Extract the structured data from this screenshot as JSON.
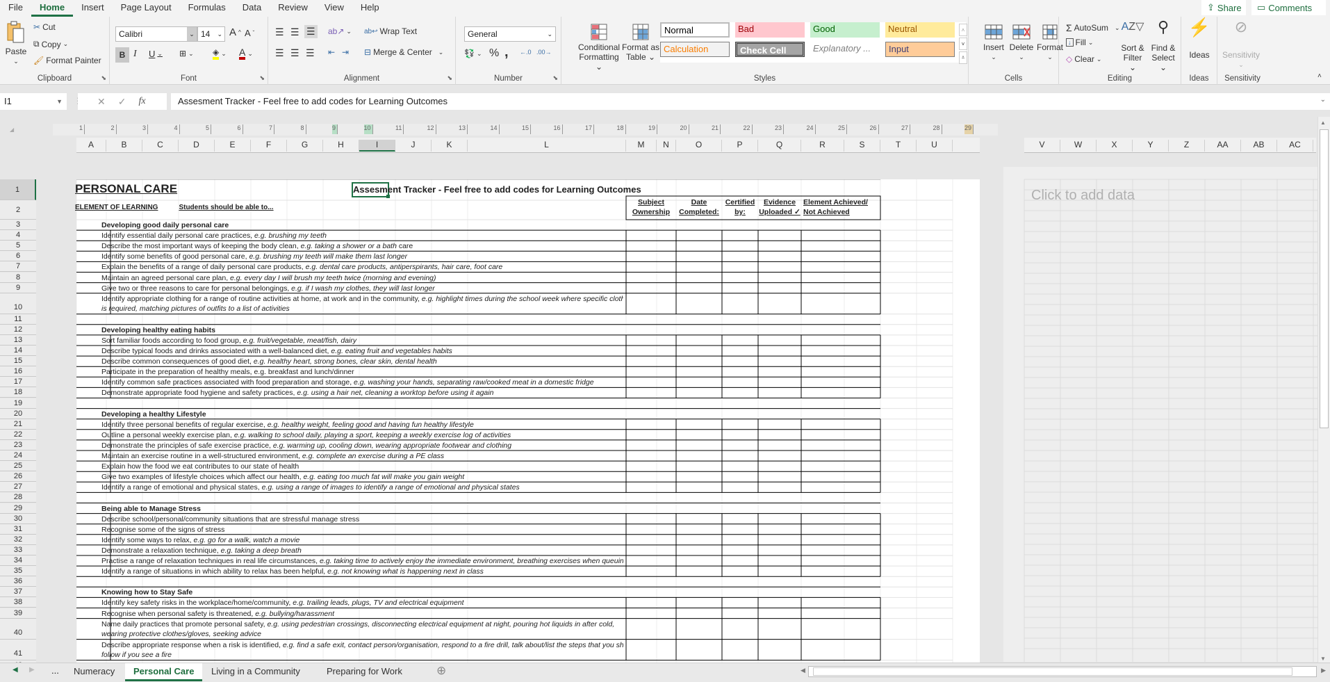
{
  "menu": {
    "items": [
      "File",
      "Home",
      "Insert",
      "Page Layout",
      "Formulas",
      "Data",
      "Review",
      "View",
      "Help"
    ],
    "active": "Home"
  },
  "header_buttons": {
    "share": "Share",
    "comments": "Comments"
  },
  "ribbon": {
    "clipboard": {
      "label": "Clipboard",
      "paste": "Paste",
      "cut": "Cut",
      "copy": "Copy",
      "format_painter": "Format Painter"
    },
    "font": {
      "label": "Font",
      "font_name": "Calibri",
      "font_size": "14",
      "bold": "B",
      "italic": "I",
      "underline": "U",
      "font_color": "#c00000",
      "highlight_color": "#ffff00"
    },
    "alignment": {
      "label": "Alignment",
      "wrap_text": "Wrap Text",
      "merge_center": "Merge & Center"
    },
    "number": {
      "label": "Number",
      "format": "General",
      "percent": "%",
      "comma": ","
    },
    "styles": {
      "label": "Styles",
      "conditional_formatting": [
        "Conditional",
        "Formatting"
      ],
      "format_as_table": [
        "Format as",
        "Table"
      ],
      "cells": [
        {
          "name": "Normal",
          "bg": "#ffffff",
          "color": "#000000"
        },
        {
          "name": "Bad",
          "bg": "#ffc7ce",
          "color": "#9c0006"
        },
        {
          "name": "Good",
          "bg": "#c6efce",
          "color": "#006100"
        },
        {
          "name": "Neutral",
          "bg": "#ffeb9c",
          "color": "#9c5700"
        },
        {
          "name": "Calculation",
          "bg": "#f2f2f2",
          "color": "#fa7d00"
        },
        {
          "name": "Check Cell",
          "bg": "#a5a5a5",
          "color": "#ffffff"
        },
        {
          "name": "Explanatory ...",
          "bg": "#ffffff",
          "color": "#7f7f7f"
        },
        {
          "name": "Input",
          "bg": "#ffcc99",
          "color": "#3f3f76"
        }
      ]
    },
    "cells": {
      "label": "Cells",
      "insert": "Insert",
      "delete": "Delete",
      "format": "Format"
    },
    "editing": {
      "label": "Editing",
      "autosum": "AutoSum",
      "fill": "Fill",
      "clear": "Clear",
      "sort_filter": [
        "Sort &",
        "Filter"
      ],
      "find_select": [
        "Find &",
        "Select"
      ]
    },
    "ideas": {
      "label": "Ideas",
      "button": "Ideas"
    },
    "sensitivity": {
      "label": "Sensitivity",
      "button": "Sensitivity"
    }
  },
  "formula_bar": {
    "name_box": "I1",
    "formula": "Assesment Tracker - Feel free to add codes for Learning Outcomes"
  },
  "columns": [
    "A",
    "B",
    "C",
    "D",
    "E",
    "F",
    "G",
    "H",
    "I",
    "J",
    "K",
    "L",
    "M",
    "N",
    "O",
    "P",
    "Q",
    "R",
    "S",
    "T",
    "U"
  ],
  "columns_right": [
    "V",
    "W",
    "X",
    "Y",
    "Z",
    "AA",
    "AB",
    "AC"
  ],
  "ruler_numbers": [
    "1",
    "2",
    "3",
    "4",
    "5",
    "6",
    "7",
    "8",
    "9",
    "10",
    "11",
    "12",
    "13",
    "14",
    "15",
    "16",
    "17",
    "18",
    "19",
    "20",
    "21",
    "22",
    "23",
    "24",
    "25",
    "26",
    "27",
    "28",
    "29"
  ],
  "sheet": {
    "title": "PERSONAL CARE",
    "tracker_title": "Assesment Tracker - Feel free to add codes for Learning Outcomes",
    "element_label": "ELEMENT OF LEARNING",
    "students_label": "Students should be able to...",
    "headers": [
      [
        "Subject",
        "Ownership"
      ],
      [
        "Date",
        "Completed:"
      ],
      [
        "Certified",
        "by:"
      ],
      [
        "Evidence",
        "Uploaded ✓"
      ],
      [
        "Element Achieved/",
        "Not Achieved"
      ]
    ],
    "rows": [
      {
        "n": "1"
      },
      {
        "n": "2"
      },
      {
        "n": "3",
        "type": "section",
        "text": "Developing good daily personal care"
      },
      {
        "n": "4",
        "text": "Identify essential daily personal care practices, ",
        "eg": "e.g. brushing my teeth"
      },
      {
        "n": "5",
        "text": "Describe the most important ways of keeping the body clean, ",
        "eg": "e.g. taking a shower or a bath",
        "tail": "  care"
      },
      {
        "n": "6",
        "text": "Identify some benefits of good personal care, ",
        "eg": "e.g. brushing my teeth will make them last longer"
      },
      {
        "n": "7",
        "text": "Explain the benefits of a range of daily personal care products, ",
        "eg": "e.g. dental care products, antiperspirants, hair care, foot care"
      },
      {
        "n": "8",
        "text": "Maintain an agreed personal care plan, ",
        "eg": "e.g. every day I will brush my teeth twice (morning and evening)"
      },
      {
        "n": "9",
        "text": "Give two or three reasons to care for personal belongings, ",
        "eg": "e.g. if I wash my clothes, they will last longer"
      },
      {
        "n": "10",
        "tall": true,
        "text": "Identify appropriate clothing for a range of routine activities at home, at work and in the community, ",
        "eg": "e.g. highlight times during the school week where specific clothing",
        "line2": "is required, matching pictures of outfits to a list of activities"
      },
      {
        "n": "11",
        "type": "blank"
      },
      {
        "n": "12",
        "type": "section",
        "text": "Developing healthy eating habits"
      },
      {
        "n": "13",
        "text": "Sort familiar foods according to food group, ",
        "eg": "e.g. fruit/vegetable, meat/fish, dairy"
      },
      {
        "n": "14",
        "text": "Describe typical foods and drinks associated with a well-balanced diet, ",
        "eg": "e.g. eating fruit and vegetables habits"
      },
      {
        "n": "15",
        "text": "Describe common consequences of good diet, ",
        "eg": "e.g. healthy heart, strong bones, clear skin, dental health"
      },
      {
        "n": "16",
        "text": "Participate in the preparation of healthy meals, e.g. breakfast and lunch/dinner"
      },
      {
        "n": "17",
        "text": " Identify common safe practices associated with food preparation and storage, ",
        "eg": "e.g. washing your hands, separating raw/cooked meat in a domestic fridge"
      },
      {
        "n": "18",
        "text": "Demonstrate appropriate food hygiene and safety practices, ",
        "eg": "e.g. using a hair net, cleaning a worktop before using it again"
      },
      {
        "n": "19",
        "type": "blank"
      },
      {
        "n": "20",
        "type": "section",
        "text": "Developing a healthy Lifestyle"
      },
      {
        "n": "21",
        "text": "Identify three personal benefits of regular exercise, ",
        "eg": "e.g. healthy weight, feeling good and having fun healthy lifestyle"
      },
      {
        "n": "22",
        "text": "Outline a personal weekly exercise plan, ",
        "eg": "e.g. walking to school daily, playing a sport, keeping a weekly exercise log of activities"
      },
      {
        "n": "23",
        "text": "Demonstrate the principles of safe exercise practice, ",
        "eg": "e.g. warming up, cooling down, wearing appropriate footwear and clothing"
      },
      {
        "n": "24",
        "text": "Maintain an exercise routine in a well-structured environment, ",
        "eg": "e.g. complete an exercise during a PE class"
      },
      {
        "n": "25",
        "text": "Explain how the food we eat contributes to our state of health"
      },
      {
        "n": "26",
        "text": "Give two examples of lifestyle choices which affect our health, ",
        "eg": "e.g. eating too much fat will make you gain weight"
      },
      {
        "n": "27",
        "text": "Identify a range of emotional and physical states, ",
        "eg": "e.g. using a range of images to identify a range of emotional and physical states"
      },
      {
        "n": "28",
        "type": "blank"
      },
      {
        "n": "29",
        "type": "section",
        "text": "Being able to Manage Stress"
      },
      {
        "n": "30",
        "text": "Describe school/personal/community situations that are stressful manage stress"
      },
      {
        "n": "31",
        "text": "Recognise some of the signs of stress"
      },
      {
        "n": "32",
        "text": "Identify some ways to relax, ",
        "eg": "e.g. go for a walk, watch a movie"
      },
      {
        "n": "33",
        "text": "Demonstrate a relaxation technique, ",
        "eg": "e.g. taking a deep breath"
      },
      {
        "n": "34",
        "text": "Practise a range of relaxation techniques in real life circumstances, ",
        "eg": "e.g. taking time to actively enjoy the immediate environment, breathing exercises when queuing"
      },
      {
        "n": "35",
        "text": "Identify a range of situations in which ability to relax has been helpful, ",
        "eg": "e.g. not knowing what is happening next in class"
      },
      {
        "n": "36",
        "type": "blank"
      },
      {
        "n": "37",
        "type": "section",
        "text": "Knowing how to Stay Safe"
      },
      {
        "n": "38",
        "text": "Identify key safety risks in the workplace/home/community, ",
        "eg": "e.g. trailing leads, plugs, TV and electrical equipment"
      },
      {
        "n": "39",
        "text": "Recognise when personal safety is threatened, ",
        "eg": "e.g. bullying/harassment"
      },
      {
        "n": "40",
        "tall": true,
        "text": "Name daily practices that promote personal safety, ",
        "eg": "e.g. using pedestrian crossings, disconnecting electrical equipment at night, pouring hot liquids in after cold,",
        "line2": "wearing protective clothes/gloves, seeking advice"
      },
      {
        "n": "41",
        "tall": true,
        "text": "Describe appropriate response when a risk is identified, ",
        "eg": "e.g. find a safe exit, contact person/organisation, respond to a fire drill, talk about/list the steps that you should",
        "line2": "follow if you see a fire"
      },
      {
        "n": "42",
        "type": "blank"
      }
    ]
  },
  "right_panel": {
    "placeholder": "Click to add data"
  },
  "sheet_tabs": {
    "items": [
      "Numeracy",
      "Personal Care",
      "Living in a Community",
      "Preparing for Work"
    ],
    "active": "Personal Care",
    "more": "..."
  }
}
